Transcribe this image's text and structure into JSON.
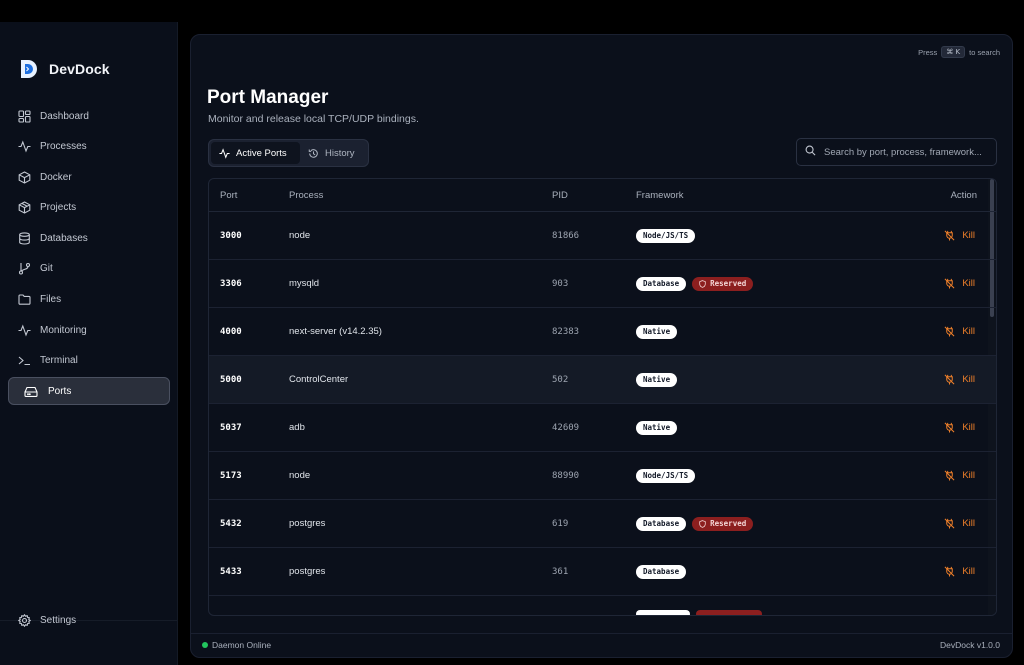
{
  "app": {
    "name": "DevDock",
    "version": "DevDock v1.0.0",
    "accent": "#f0802a"
  },
  "sidebar": {
    "items": [
      {
        "label": "Dashboard",
        "icon": "dashboard-icon"
      },
      {
        "label": "Processes",
        "icon": "activity-icon"
      },
      {
        "label": "Docker",
        "icon": "box-icon"
      },
      {
        "label": "Projects",
        "icon": "package-icon"
      },
      {
        "label": "Databases",
        "icon": "database-icon"
      },
      {
        "label": "Git",
        "icon": "git-branch-icon"
      },
      {
        "label": "Files",
        "icon": "folder-icon"
      },
      {
        "label": "Monitoring",
        "icon": "activity-icon"
      },
      {
        "label": "Terminal",
        "icon": "terminal-icon"
      },
      {
        "label": "Ports",
        "icon": "hard-drive-icon",
        "active": true
      }
    ],
    "settings_label": "Settings"
  },
  "header": {
    "hint_prefix": "Press",
    "hint_key": "⌘ K",
    "hint_suffix": "to search"
  },
  "page": {
    "title": "Port Manager",
    "subtitle": "Monitor and release local TCP/UDP bindings."
  },
  "tabs": [
    {
      "label": "Active Ports",
      "icon": "activity-icon",
      "active": true
    },
    {
      "label": "History",
      "icon": "history-icon",
      "active": false
    }
  ],
  "search": {
    "placeholder": "Search by port, process, framework..."
  },
  "table": {
    "columns": [
      "Port",
      "Process",
      "PID",
      "Framework",
      "Action"
    ],
    "rows": [
      {
        "port": "3000",
        "process": "node",
        "pid": "81866",
        "framework": "Node/JS/TS",
        "reserved": false,
        "action": "Kill"
      },
      {
        "port": "3306",
        "process": "mysqld",
        "pid": "903",
        "framework": "Database",
        "reserved": true,
        "action": "Kill"
      },
      {
        "port": "4000",
        "process": "next-server (v14.2.35)",
        "pid": "82383",
        "framework": "Native",
        "reserved": false,
        "action": "Kill"
      },
      {
        "port": "5000",
        "process": "ControlCenter",
        "pid": "502",
        "framework": "Native",
        "reserved": false,
        "action": "Kill",
        "highlighted": true
      },
      {
        "port": "5037",
        "process": "adb",
        "pid": "42609",
        "framework": "Native",
        "reserved": false,
        "action": "Kill"
      },
      {
        "port": "5173",
        "process": "node",
        "pid": "88990",
        "framework": "Node/JS/TS",
        "reserved": false,
        "action": "Kill"
      },
      {
        "port": "5432",
        "process": "postgres",
        "pid": "619",
        "framework": "Database",
        "reserved": true,
        "action": "Kill"
      },
      {
        "port": "5433",
        "process": "postgres",
        "pid": "361",
        "framework": "Database",
        "reserved": false,
        "action": "Kill"
      }
    ],
    "reserved_label": "Reserved"
  },
  "footer": {
    "status": "Daemon Online",
    "status_color": "#22c55e"
  }
}
